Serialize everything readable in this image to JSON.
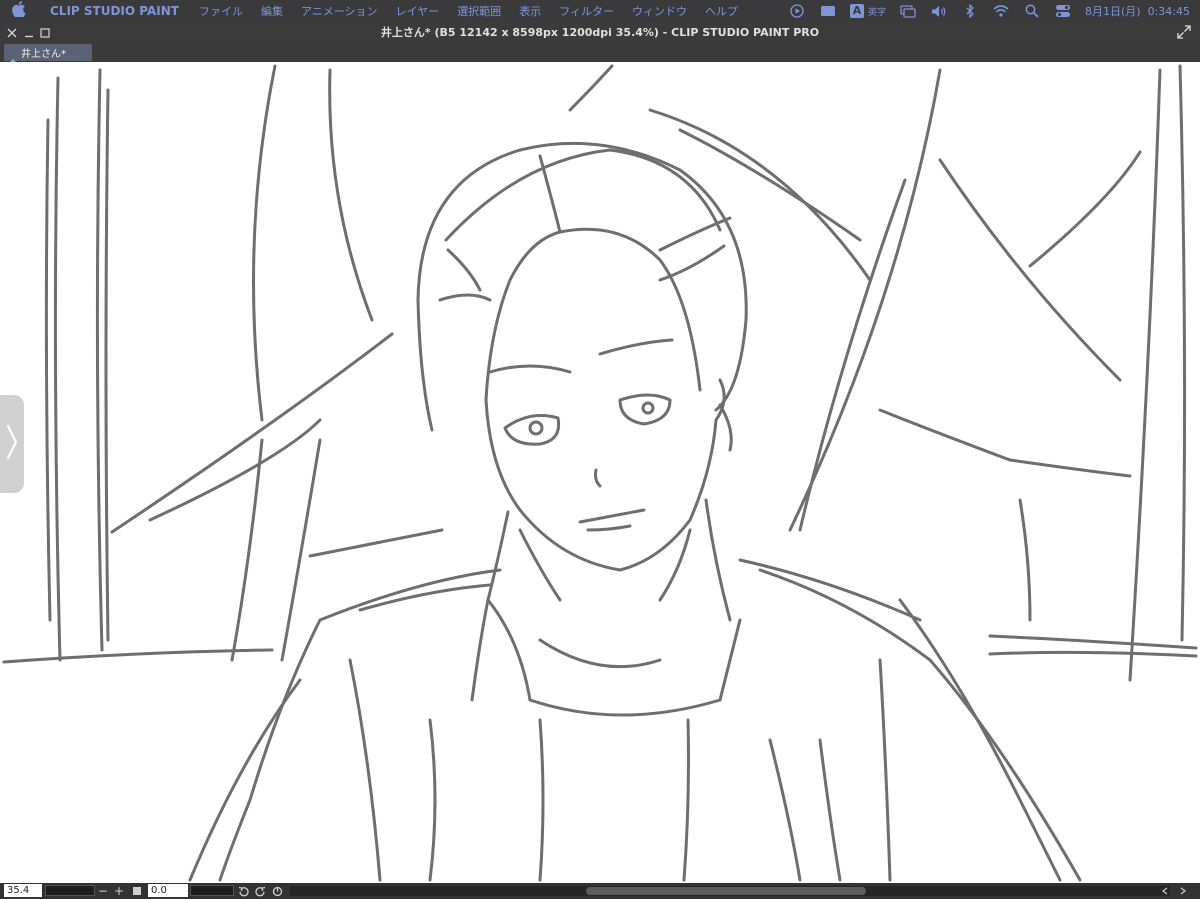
{
  "menubar": {
    "app_name": "CLIP STUDIO PAINT",
    "items": [
      "ファイル",
      "編集",
      "アニメーション",
      "レイヤー",
      "選択範囲",
      "表示",
      "フィルター",
      "ウィンドウ",
      "ヘルプ"
    ],
    "input_mode": "英字",
    "input_badge": "A",
    "date": "8月1日(月)",
    "time": "0:34:45"
  },
  "window": {
    "title": "井上さん* (B5 12142 x 8598px 1200dpi 35.4%)  - CLIP STUDIO PAINT PRO"
  },
  "tab": {
    "label": "井上さん*"
  },
  "statusbar": {
    "zoom_value": "35.4",
    "zoom_out": "−",
    "zoom_in": "+",
    "angle_value": "0.0"
  },
  "icons": {
    "apple": "apple-icon",
    "close": "close-icon",
    "minimize": "minimize-icon",
    "maximize": "maximize-icon",
    "expand": "expand-icon",
    "panel": "chevron-right-icon",
    "accent_color": "#7f95d6"
  }
}
